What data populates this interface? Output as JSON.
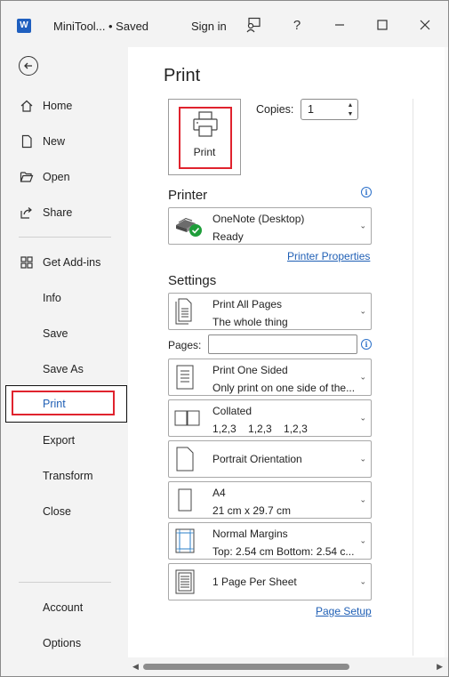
{
  "window": {
    "app_icon_letter": "W",
    "doc_title": "MiniTool...",
    "save_status": "• Saved",
    "sign_in": "Sign in"
  },
  "titlebar_icons": {
    "coauthor": "coauthor-icon",
    "help": "?",
    "minimize": "—",
    "maximize": "□",
    "close": "✕"
  },
  "sidebar": {
    "back": "back-arrow-icon",
    "items": [
      {
        "label": "Home",
        "icon": "home-icon"
      },
      {
        "label": "New",
        "icon": "new-document-icon"
      },
      {
        "label": "Open",
        "icon": "open-folder-icon"
      },
      {
        "label": "Share",
        "icon": "share-icon"
      },
      {
        "label": "Get Add-ins",
        "icon": "add-ins-icon"
      },
      {
        "label": "Info"
      },
      {
        "label": "Save"
      },
      {
        "label": "Save As"
      },
      {
        "label": "Print"
      },
      {
        "label": "Export"
      },
      {
        "label": "Transform"
      },
      {
        "label": "Close"
      },
      {
        "label": "Account"
      },
      {
        "label": "Options"
      }
    ],
    "active": "Print"
  },
  "main": {
    "title": "Print",
    "print_button_label": "Print",
    "copies_label": "Copies:",
    "copies_value": "1",
    "printer_heading": "Printer",
    "printer": {
      "name": "OneNote (Desktop)",
      "status": "Ready"
    },
    "printer_properties_link": "Printer Properties",
    "settings_heading": "Settings",
    "pages_label": "Pages:",
    "pages_value": "",
    "settings": [
      {
        "line1": "Print All Pages",
        "line2": "The whole thing",
        "icon": "pages-icon"
      },
      {
        "line1": "Print One Sided",
        "line2": "Only print on one side of the...",
        "icon": "one-sided-icon"
      },
      {
        "line1": "Collated",
        "line2": "1,2,3    1,2,3    1,2,3",
        "icon": "collated-icon"
      },
      {
        "line1": "Portrait Orientation",
        "line2": "",
        "icon": "portrait-icon"
      },
      {
        "line1": "A4",
        "line2": "21 cm x 29.7 cm",
        "icon": "paper-size-icon"
      },
      {
        "line1": "Normal Margins",
        "line2": "Top: 2.54 cm Bottom: 2.54 c...",
        "icon": "margins-icon"
      },
      {
        "line1": "1 Page Per Sheet",
        "line2": "",
        "icon": "pages-per-sheet-icon"
      }
    ],
    "page_setup_link": "Page Setup"
  },
  "colors": {
    "highlight_red": "#e0232e",
    "link_blue": "#1f5fb5",
    "sidebar_bg": "#f3f3f3"
  }
}
